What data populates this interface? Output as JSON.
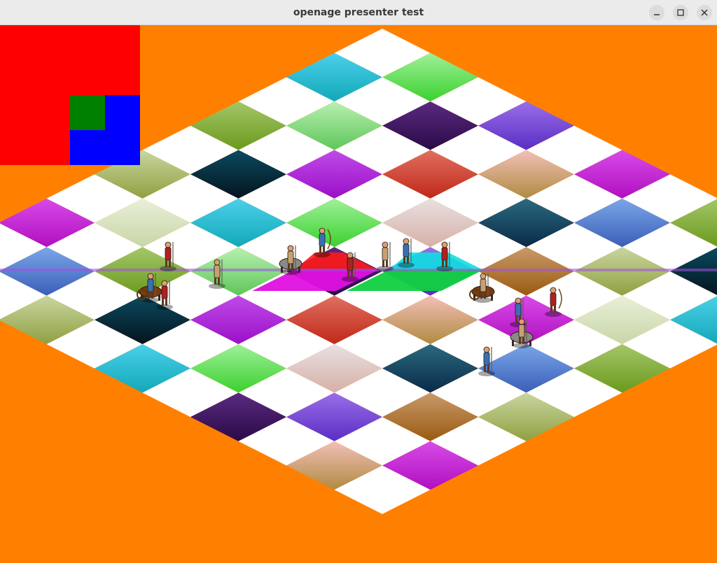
{
  "window": {
    "title": "openage presenter test"
  },
  "scene": {
    "background_color": "#ff8000",
    "board_rows": 10,
    "board_cols": 10,
    "checker_light_color": "#ffffff",
    "minimap_colors": {
      "red": "#ff0000",
      "blue": "#0000ff",
      "green": "#008000"
    },
    "units": [
      {
        "kind": "infantry"
      },
      {
        "kind": "infantry"
      },
      {
        "kind": "chariot"
      },
      {
        "kind": "infantry"
      },
      {
        "kind": "cavalry"
      },
      {
        "kind": "archer"
      },
      {
        "kind": "infantry"
      },
      {
        "kind": "infantry"
      },
      {
        "kind": "infantry"
      },
      {
        "kind": "infantry"
      },
      {
        "kind": "chariot"
      },
      {
        "kind": "infantry"
      },
      {
        "kind": "archer"
      },
      {
        "kind": "cavalry"
      },
      {
        "kind": "infantry"
      }
    ]
  }
}
